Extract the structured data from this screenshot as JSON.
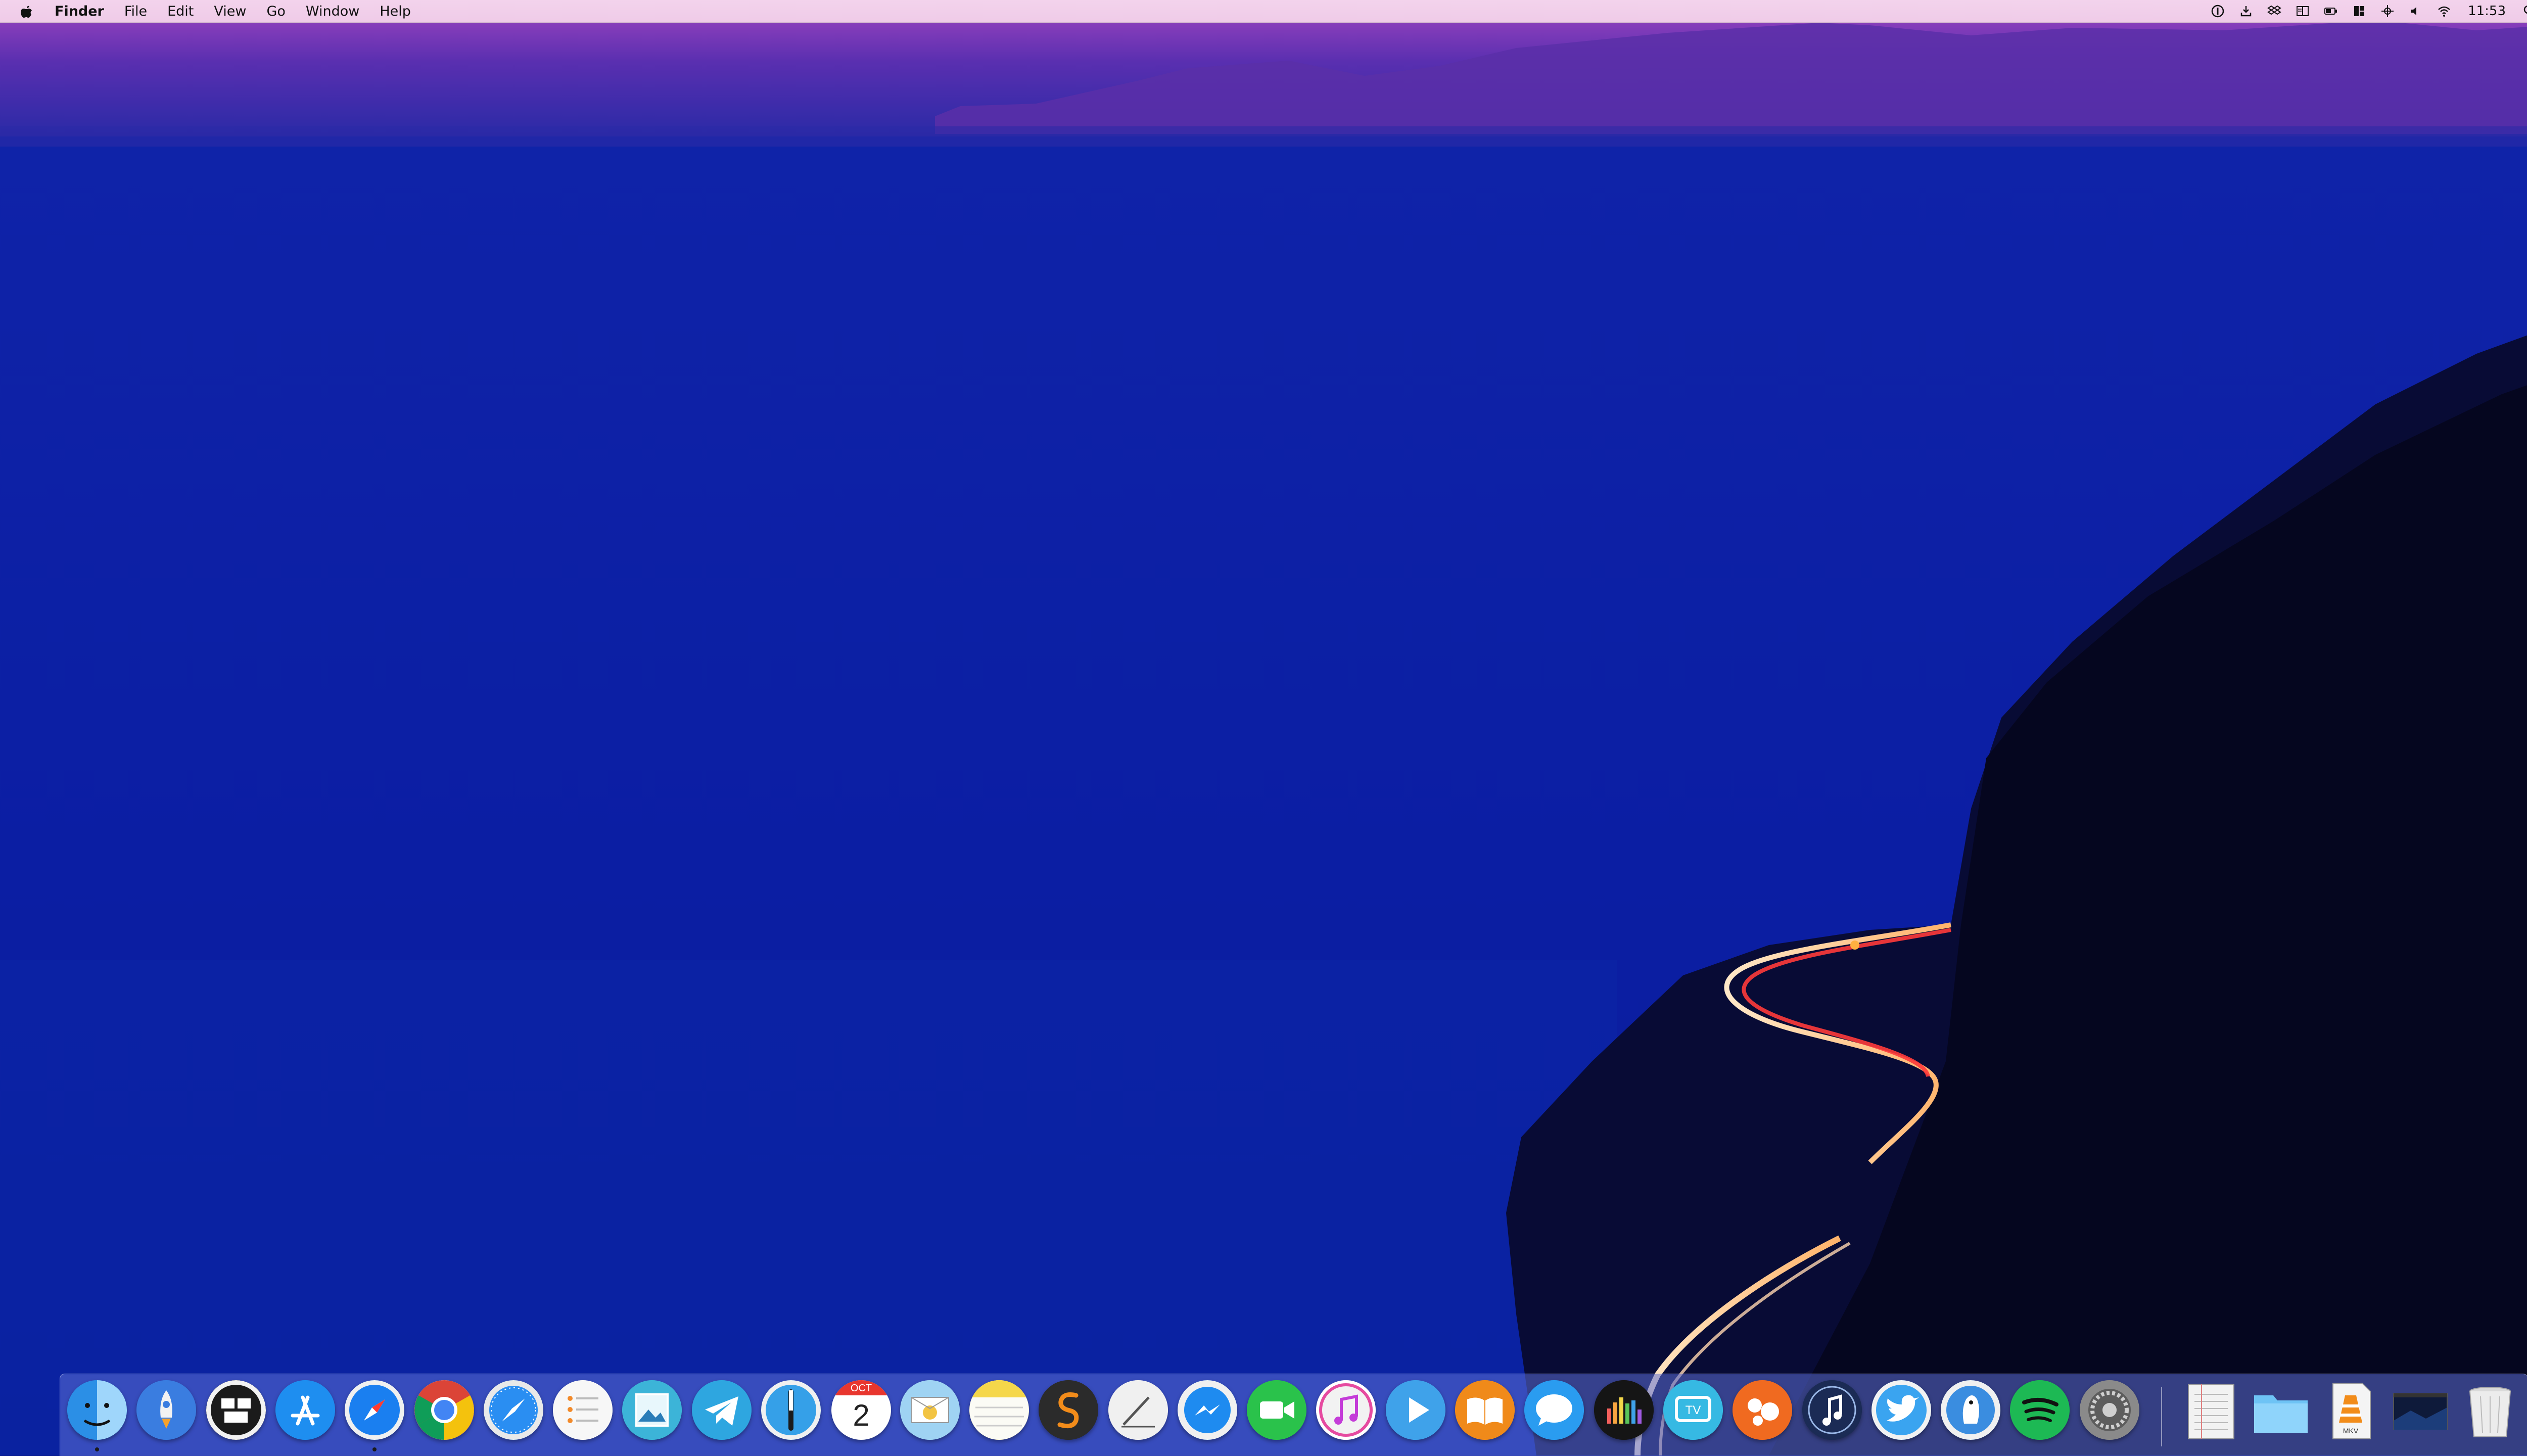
{
  "menubar": {
    "app_name": "Finder",
    "menus": [
      "File",
      "Edit",
      "View",
      "Go",
      "Window",
      "Help"
    ],
    "clock": "11:53",
    "status_icons": [
      "1password-icon",
      "download-icon",
      "dropbox-icon",
      "window-layout-icon",
      "battery-icon",
      "magnet-icon",
      "crosshair-icon",
      "volume-icon",
      "wifi-icon",
      "clock",
      "spotlight-icon",
      "notification-center-icon"
    ]
  },
  "wallpaper": {
    "sky_color": "#9a3fbf",
    "sea_color": "#0d1fa6",
    "cliff_color": "#06082a"
  },
  "dock": {
    "apps": [
      {
        "name": "finder-icon",
        "color": "#2b8fe6",
        "running": true
      },
      {
        "name": "launchpad-icon",
        "color": "#3a7de0",
        "running": false
      },
      {
        "name": "mission-control-icon",
        "color": "#1b1b1b",
        "running": false
      },
      {
        "name": "app-store-icon",
        "color": "#1e8ef0",
        "running": false
      },
      {
        "name": "safari-icon",
        "color": "#1a7ff0",
        "running": true
      },
      {
        "name": "chrome-icon",
        "color": "#e8e8e8",
        "running": false
      },
      {
        "name": "safari-compass-icon",
        "color": "#2a8ef2",
        "running": false
      },
      {
        "name": "reminders-icon",
        "color": "#f7f7f7",
        "running": false
      },
      {
        "name": "preview-icon",
        "color": "#3cb4d8",
        "running": false
      },
      {
        "name": "telegram-icon",
        "color": "#2ea6e0",
        "running": false
      },
      {
        "name": "tempi-icon",
        "color": "#35a0e8",
        "running": false
      },
      {
        "name": "calendar-icon",
        "color": "#ffffff",
        "running": false
      },
      {
        "name": "photos-mail-icon",
        "color": "#9fd3f3",
        "running": false
      },
      {
        "name": "notes-icon",
        "color": "#f5d74a",
        "running": false
      },
      {
        "name": "sublime-text-icon",
        "color": "#2b2b2b",
        "running": false
      },
      {
        "name": "script-editor-icon",
        "color": "#f0f0f0",
        "running": false
      },
      {
        "name": "messenger-icon",
        "color": "#1e8bf0",
        "running": false
      },
      {
        "name": "facetime-icon",
        "color": "#2ac24b",
        "running": false
      },
      {
        "name": "itunes-icon",
        "color": "#ffffff",
        "running": false
      },
      {
        "name": "infuse-icon",
        "color": "#3fa2ea",
        "running": false
      },
      {
        "name": "ibooks-icon",
        "color": "#f08a1a",
        "running": false
      },
      {
        "name": "messages-icon",
        "color": "#2a9cf0",
        "running": false
      },
      {
        "name": "equalizer-icon",
        "color": "#151515",
        "running": false
      },
      {
        "name": "tv-icon",
        "color": "#36b9e3",
        "running": false
      },
      {
        "name": "cleaner-icon",
        "color": "#f06a20",
        "running": false
      },
      {
        "name": "capo-icon",
        "color": "#1b2b55",
        "running": false
      },
      {
        "name": "twitter-icon",
        "color": "#3aa4f0",
        "running": false
      },
      {
        "name": "cyberduck-icon",
        "color": "#3a8de0",
        "running": false
      },
      {
        "name": "spotify-icon",
        "color": "#1db954",
        "running": false
      },
      {
        "name": "system-preferences-icon",
        "color": "#8a8a8a",
        "running": false
      }
    ],
    "documents": [
      {
        "name": "document-stack-icon"
      },
      {
        "name": "folder-icon"
      },
      {
        "name": "mkv-file-icon",
        "label": "MKV"
      },
      {
        "name": "screenshot-file-icon"
      },
      {
        "name": "trash-icon"
      }
    ],
    "calendar_month": "OCT",
    "calendar_day": "2"
  }
}
